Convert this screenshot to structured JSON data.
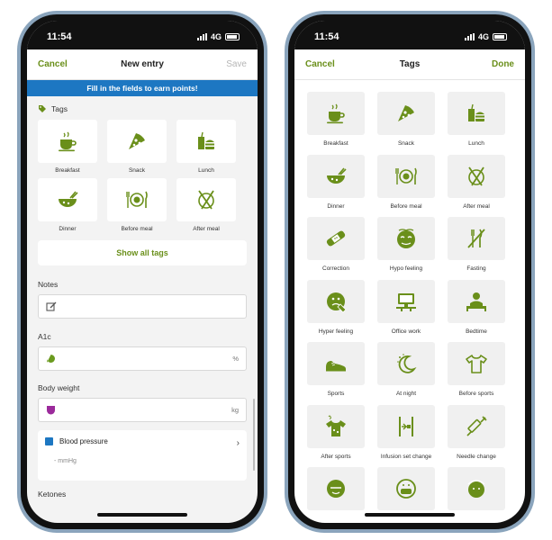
{
  "left": {
    "status": {
      "time": "11:54",
      "network": "4G"
    },
    "nav": {
      "cancel": "Cancel",
      "title": "New entry",
      "save": "Save"
    },
    "banner": "Fill in the fields to earn points!",
    "tags_label": "Tags",
    "tags": [
      {
        "label": "Breakfast",
        "icon": "coffee-cup-icon"
      },
      {
        "label": "Snack",
        "icon": "pizza-slice-icon"
      },
      {
        "label": "Lunch",
        "icon": "burger-drink-icon"
      },
      {
        "label": "Dinner",
        "icon": "bowl-icon"
      },
      {
        "label": "Before meal",
        "icon": "plate-fork-knife-icon"
      },
      {
        "label": "After meal",
        "icon": "empty-plate-icon"
      }
    ],
    "show_all": "Show all tags",
    "notes_label": "Notes",
    "a1c_label": "A1c",
    "a1c_unit": "%",
    "weight_label": "Body weight",
    "weight_unit": "kg",
    "bp_label": "Blood pressure",
    "bp_sub": "- mmHg",
    "ketones_label": "Ketones",
    "colors": {
      "accent": "#6a8f1a",
      "banner": "#1d77c2",
      "a1c": "#6a9a1e",
      "weight": "#9b2a9b",
      "bp": "#1d77c2"
    }
  },
  "right": {
    "status": {
      "time": "11:54",
      "network": "4G"
    },
    "nav": {
      "cancel": "Cancel",
      "title": "Tags",
      "done": "Done"
    },
    "tags": [
      {
        "label": "Breakfast",
        "icon": "coffee-cup-icon"
      },
      {
        "label": "Snack",
        "icon": "pizza-slice-icon"
      },
      {
        "label": "Lunch",
        "icon": "burger-drink-icon"
      },
      {
        "label": "Dinner",
        "icon": "bowl-icon"
      },
      {
        "label": "Before meal",
        "icon": "plate-fork-knife-icon"
      },
      {
        "label": "After meal",
        "icon": "empty-plate-icon"
      },
      {
        "label": "Correction",
        "icon": "bandage-icon"
      },
      {
        "label": "Hypo feeling",
        "icon": "dizzy-face-icon"
      },
      {
        "label": "Fasting",
        "icon": "no-fork-knife-icon"
      },
      {
        "label": "Hyper feeling",
        "icon": "sick-face-icon"
      },
      {
        "label": "Office work",
        "icon": "computer-desk-icon"
      },
      {
        "label": "Bedtime",
        "icon": "person-bed-icon"
      },
      {
        "label": "Sports",
        "icon": "sneaker-icon"
      },
      {
        "label": "At night",
        "icon": "moon-stars-icon"
      },
      {
        "label": "Before sports",
        "icon": "tshirt-icon"
      },
      {
        "label": "After sports",
        "icon": "sweaty-tshirt-icon"
      },
      {
        "label": "Infusion set change",
        "icon": "infusion-set-icon"
      },
      {
        "label": "Needle change",
        "icon": "needle-icon"
      },
      {
        "label": "",
        "icon": "face-icon"
      },
      {
        "label": "",
        "icon": "face-mask-icon"
      },
      {
        "label": "",
        "icon": "face-splash-icon"
      }
    ]
  }
}
